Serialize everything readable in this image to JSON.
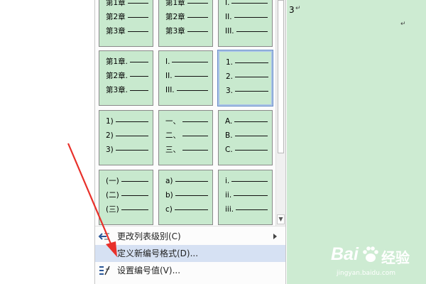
{
  "document": {
    "text": "3",
    "para_mark": "↵",
    "para_mark_right": "↵",
    "background": "#cdebd2"
  },
  "gallery": {
    "tile_color": "#c8e9ce",
    "selected_index": 5,
    "tiles": [
      {
        "rows": [
          "第1章",
          "第2章",
          "第3章"
        ]
      },
      {
        "rows": [
          "第1章",
          "第2章",
          "第3章"
        ]
      },
      {
        "rows": [
          "I.",
          "II.",
          "III."
        ]
      },
      {
        "rows": [
          "第1章.",
          "第2章.",
          "第3章."
        ]
      },
      {
        "rows": [
          "I.",
          "II.",
          "III."
        ]
      },
      {
        "rows": [
          "1.",
          "2.",
          "3."
        ]
      },
      {
        "rows": [
          "1)",
          "2)",
          "3)"
        ]
      },
      {
        "rows": [
          "一、",
          "二、",
          "三、"
        ]
      },
      {
        "rows": [
          "A.",
          "B.",
          "C."
        ]
      },
      {
        "rows": [
          "(一)",
          "(二)",
          "(三)"
        ]
      },
      {
        "rows": [
          "a)",
          "b)",
          "c)"
        ]
      },
      {
        "rows": [
          "i.",
          "ii.",
          "iii."
        ]
      }
    ]
  },
  "menu": {
    "change_level": "更改列表级别(C)",
    "define_format": "定义新编号格式(D)...",
    "set_value": "设置编号值(V)...",
    "hover_color": "#d6e1f3"
  },
  "scrollbar": {
    "down_arrow": "▼"
  },
  "watermark": {
    "brand": "Bai",
    "brand_tail": "经验",
    "site": "jingyan.baidu.com"
  },
  "annotation": {
    "arrow_color": "#e8302a"
  }
}
